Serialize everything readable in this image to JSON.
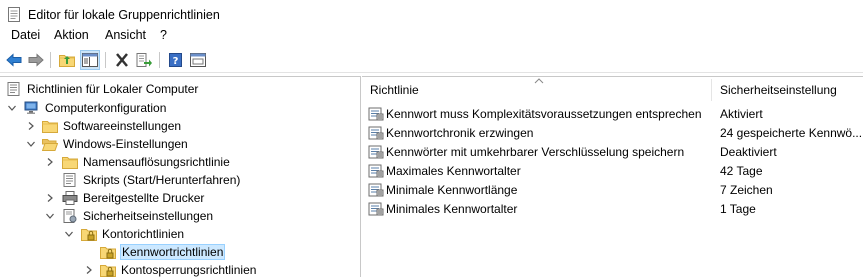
{
  "window": {
    "title": "Editor für lokale Gruppenrichtlinien"
  },
  "menu": [
    "Datei",
    "Aktion",
    "Ansicht",
    "?"
  ],
  "toolbar": {
    "icons": [
      "back-arrow-icon",
      "forward-arrow-icon",
      "up-folder-icon",
      "show-hide-tree-icon",
      "delete-icon",
      "export-list-icon",
      "help-icon",
      "properties-icon"
    ]
  },
  "tree": {
    "root": "Richtlinien für Lokaler Computer",
    "computer_config": "Computerkonfiguration",
    "software": "Softwareeinstellungen",
    "windows": "Windows-Einstellungen",
    "name_resolution": "Namensauflösungsrichtlinie",
    "scripts": "Skripts (Start/Herunterfahren)",
    "printers": "Bereitgestellte Drucker",
    "security": "Sicherheitseinstellungen",
    "account_policies": "Kontorichtlinien",
    "password_policies": "Kennwortrichtlinien",
    "lockout_policies": "Kontosperrungsrichtlinien"
  },
  "list": {
    "col_policy": "Richtlinie",
    "col_setting": "Sicherheitseinstellung",
    "rows": [
      {
        "policy": "Kennwort muss Komplexitätsvoraussetzungen entsprechen",
        "setting": "Aktiviert"
      },
      {
        "policy": "Kennwortchronik erzwingen",
        "setting": "24 gespeicherte Kennwö..."
      },
      {
        "policy": "Kennwörter mit umkehrbarer Verschlüsselung speichern",
        "setting": "Deaktiviert"
      },
      {
        "policy": "Maximales Kennwortalter",
        "setting": "42 Tage"
      },
      {
        "policy": "Minimale Kennwortlänge",
        "setting": "7 Zeichen"
      },
      {
        "policy": "Minimales Kennwortalter",
        "setting": "1 Tage"
      }
    ]
  }
}
